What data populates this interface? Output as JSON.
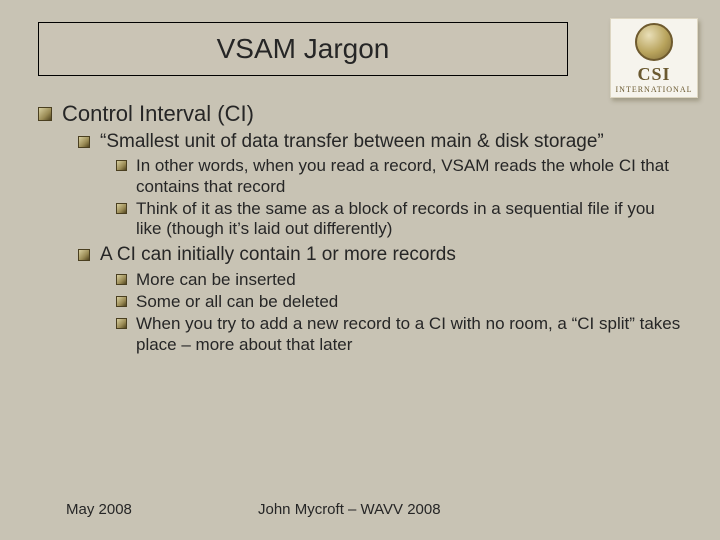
{
  "title": "VSAM Jargon",
  "logo": {
    "line1": "CSI",
    "line2": "INTERNATIONAL"
  },
  "bullets": {
    "l1_0": "Control Interval (CI)",
    "l2_0": "“Smallest unit of data transfer between main & disk storage”",
    "l3_0": "In other words, when you read a record, VSAM reads the whole CI that contains that record",
    "l3_1": "Think of it as the same as a block of records in a sequential file if you like (though it’s laid out differently)",
    "l2_1": "A CI can initially contain 1 or more records",
    "l3_2": "More can be inserted",
    "l3_3": "Some or all can be deleted",
    "l3_4": "When you try to add a new record to a CI with no room, a “CI split” takes place – more about that later"
  },
  "footer": {
    "date": "May 2008",
    "author": "John Mycroft – WAVV 2008"
  }
}
